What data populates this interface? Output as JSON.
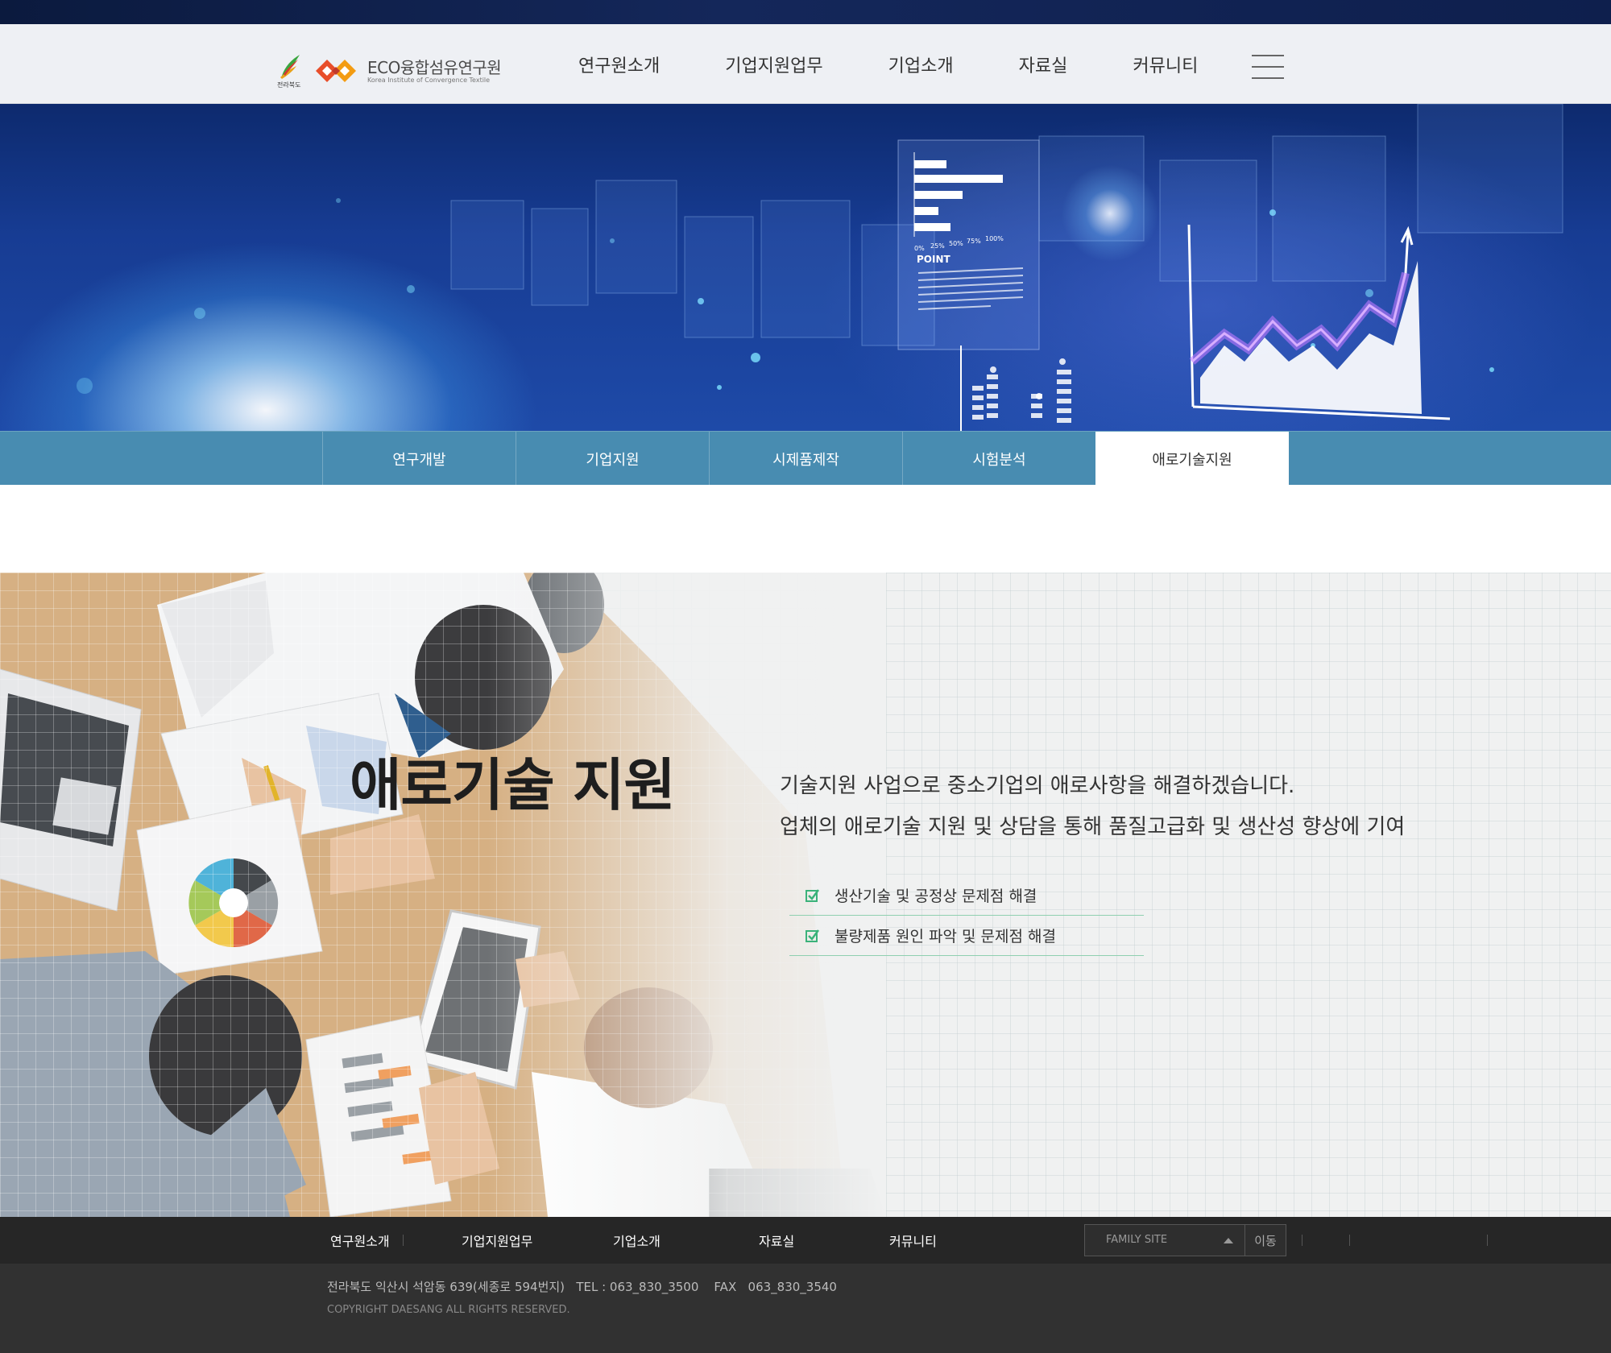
{
  "header": {
    "logo": {
      "region_label": "전라북도",
      "org_name": "ECO융합섬유연구원",
      "org_subtitle": "Korea Institute of Convergence Textile"
    },
    "nav": [
      "연구원소개",
      "기업지원업무",
      "기업소개",
      "자료실",
      "커뮤니티"
    ],
    "menu_icon": "hamburger-icon"
  },
  "hero": {
    "chart_labels": [
      "0%",
      "25%",
      "50%",
      "75%",
      "100%"
    ],
    "point_label": "POINT"
  },
  "subnav": {
    "tabs": [
      "연구개발",
      "기업지원",
      "시제품제작",
      "시험분석",
      "애로기술지원"
    ],
    "active_tab": "애로기술지원"
  },
  "content": {
    "title": "애로기술 지원",
    "description": [
      "기술지원 사업으로 중소기업의 애로사항을 해결하겠습니다.",
      "업체의 애로기술 지원 및 상담을 통해 품질고급화 및 생산성 향상에 기여"
    ],
    "checklist": [
      "생산기술 및 공정상 문제점 해결",
      "불량제품 원인 파악 및 문제점 해결"
    ],
    "accent_color": "#3bb27a"
  },
  "footer": {
    "nav": [
      "연구원소개",
      "기업지원업무",
      "기업소개",
      "자료실",
      "커뮤니티"
    ],
    "family_site_placeholder": "FAMILY SITE",
    "go_button": "이동",
    "address": "전라북도 익산시 석암동 639(세종로 594번지)   TEL : 063_830_3500    FAX   063_830_3540",
    "copyright": "COPYRIGHT DAESANG ALL RIGHTS RESERVED."
  }
}
